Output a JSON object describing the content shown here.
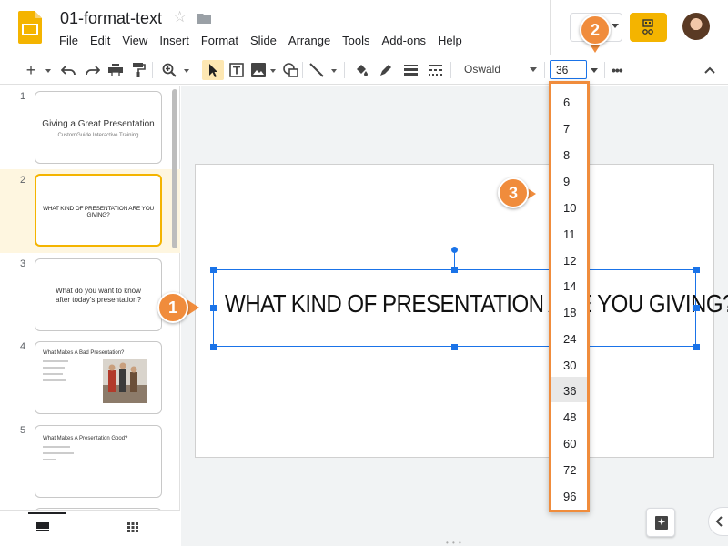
{
  "app": {
    "doc_title": "01-format-text",
    "menu": [
      "File",
      "Edit",
      "View",
      "Insert",
      "Format",
      "Slide",
      "Arrange",
      "Tools",
      "Add-ons",
      "Help"
    ],
    "accent": "#f4b400",
    "callout_color": "#f08c3c",
    "selection_color": "#1a73e8"
  },
  "toolbar": {
    "font_name": "Oswald",
    "font_size": "36",
    "icons": [
      "add-icon",
      "undo-icon",
      "redo-icon",
      "print-icon",
      "paint-format-icon",
      "zoom-icon",
      "select-icon",
      "text-box-icon",
      "image-icon",
      "shape-icon",
      "line-icon",
      "fill-color-icon",
      "border-color-icon",
      "border-weight-icon",
      "border-dash-icon",
      "more-icon",
      "collapse-icon"
    ]
  },
  "filmstrip": {
    "slides": [
      {
        "num": "1",
        "title": "Giving a Great Presentation",
        "subtitle": "CustomGuide Interactive Training"
      },
      {
        "num": "2",
        "title": "WHAT KIND OF PRESENTATION ARE YOU GIVING?"
      },
      {
        "num": "3",
        "title": "What do you want to know after today's presentation?"
      },
      {
        "num": "4",
        "title": "What Makes A Bad Presentation?"
      },
      {
        "num": "5",
        "title": "What Makes A Presentation Good?"
      }
    ]
  },
  "slide": {
    "text": "WHAT KIND OF PRESENTATION ARE YOU GIVING?"
  },
  "size_dropdown": {
    "options": [
      "6",
      "7",
      "8",
      "9",
      "10",
      "11",
      "12",
      "14",
      "18",
      "24",
      "30",
      "36",
      "48",
      "60",
      "72",
      "96"
    ],
    "selected": "36"
  },
  "callouts": [
    "1",
    "2",
    "3"
  ]
}
